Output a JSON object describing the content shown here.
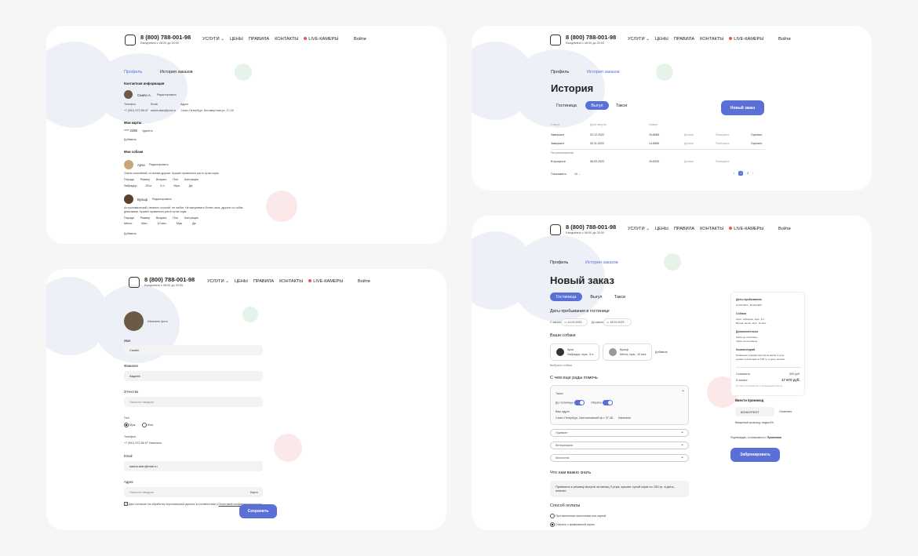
{
  "header": {
    "phone": "8 (800) 788-001-98",
    "hours": "Ежедневно с 08:00 до 20:00",
    "nav": [
      "УСЛУГИ ⌄",
      "ЦЕНЫ",
      "ПРАВИЛА",
      "КОНТАКТЫ",
      "LIVE-КАМЕРЫ"
    ],
    "login": "Войти"
  },
  "profile": {
    "tabs": [
      "Профиль",
      "История заказов"
    ],
    "contact_title": "Контактная информация",
    "name": "Семён А.",
    "edit": "Редактировать",
    "cols": [
      "Телефон",
      "Email",
      "Адрес"
    ],
    "vals": [
      "+7 (951) 572-86-97",
      "sasha.atan@post.ru",
      "Санкт-Петербург, Бессмертная ул. 17-18"
    ],
    "cards_title": "Мои карты",
    "card": "**** 2465",
    "card_del": "Удалить",
    "add": "Добавить",
    "dogs_title": "Мои собаки",
    "dog1": {
      "name": "Арчи",
      "edit": "Редактировать",
      "desc": "Очень спокойный, со всеми дружит. Кушает правильно раз в сутки корм.",
      "h": [
        "Порода",
        "Размер",
        "Возраст",
        "Пол",
        "Кастрация"
      ],
      "v": [
        "Лабрадор",
        "25 кг",
        "5 л.",
        "Муж.",
        "Да"
      ]
    },
    "dog2": {
      "name": "Вульф",
      "edit": "Редактировать",
      "desc": "Астрономический, немного строгий, не любит. Не выгуливать более часа, дружит со собак",
      "desc2": "девочками. Кушает правильно раз в сутки корм.",
      "h": [
        "Порода",
        "Размер",
        "Возраст",
        "Пол",
        "Кастрация"
      ],
      "v": [
        "Метис",
        "Мал.",
        "10 мес.",
        "Муж.",
        "Да"
      ]
    },
    "add2": "Добавить"
  },
  "history": {
    "tabs": [
      "Профиль",
      "История заказов"
    ],
    "title": "История",
    "types": [
      "Гостиница",
      "Выгул",
      "Такси"
    ],
    "new": "Новый заказ",
    "cols": [
      "Статус",
      "Дата выгула",
      "Номер"
    ],
    "rows": [
      [
        "Завершен",
        "22.12.2022",
        "19-8085",
        "Детали",
        "Повторить",
        "Оценить"
      ],
      [
        "Завершен",
        "03.11.2022",
        "14-8589",
        "Детали",
        "Повторить",
        "Оценить"
      ],
      [
        "В процессе",
        "06.03.2023",
        "19-8290",
        "Детали",
        "Повторить",
        ""
      ]
    ],
    "pending": "На рассмотрении",
    "show": "Показывать",
    "per": "10 ⌄",
    "pages": [
      "‹",
      "1",
      "2",
      "›"
    ]
  },
  "edit": {
    "photo": "Изменить фото",
    "name_l": "Имя",
    "name_v": "Семён",
    "surname_l": "Фамилия",
    "surname_v": "Авдеев",
    "patr_l": "Отчество",
    "patr_v": "Начните вводить",
    "sex_l": "Пол",
    "male": "Муж.",
    "female": "Жен.",
    "phone_l": "Телефон",
    "phone_v": "+7 (951) 572-86-97",
    "change": "Изменить",
    "email_l": "Email",
    "email_v": "sasha.atan@mail.ru",
    "addr_l": "Адрес",
    "addr_v": "Начните вводить",
    "map": "Карта",
    "consent": "Даю согласие на обработку персональных данных в соответствии с",
    "policy": "Политикой конфиденциальности",
    "save": "Сохранить"
  },
  "order": {
    "tabs": [
      "Профиль",
      "История заказов"
    ],
    "title": "Новый заказ",
    "types": [
      "Гостиница",
      "Выгул",
      "Такси"
    ],
    "dates_t": "Даты пребывания в гостинице",
    "from": "С какого",
    "from_v": "14.03.2023",
    "to": "До какого",
    "to_v": "18.03.2023",
    "dogs_t": "Ваши собаки",
    "dog1": "Арчи",
    "dog1d": "Лабрадор, муж., 5 л.",
    "dog2": "Вульф",
    "dog2d": "Метис, муж., 10 мес.",
    "add": "Добавить",
    "chosen": "Выбраны собаки",
    "help_t": "С чем еще рады помочь",
    "taxi": "Такси",
    "to_hotel": "До гостиницы",
    "back": "Обратно",
    "addr_t": "Ваш адрес",
    "addr": "Санкт-Петербург, Светлановский пр-т 37-38",
    "change": "Изменить",
    "opts": [
      "Грумминг",
      "Ветеринария",
      "Кинология"
    ],
    "know_t": "Что нам важно знать",
    "know": "Привыкли к режиму выгула за месяц 3 утра, кушает сухой корм по 150 гр. в день,",
    "know2": "молоко",
    "pay_t": "Способ оплаты",
    "pay1": "При заселении наличными или картой",
    "pay2": "Списать с привязанной карты",
    "side": {
      "dates_l": "Даты пребывания",
      "dates_v": "14.03.2023 - 18.03.2023",
      "dogs_l": "Собаки",
      "dogs_v": "Арчи, лабрадор, муж., 5 л.",
      "dogs_v2": "Вульф, метис, муж., 10 мес.",
      "extra_l": "Дополнительно",
      "extra_v": "Такси до гостиницы",
      "extra_v2": "Такси из гостиницы",
      "com_l": "Комментарий",
      "com_v": "Привыкли к режиму выгула за месяц 3 утра,",
      "com_v2": "кушает сухой корм по 150 гр. в день, молоко",
      "sum_l": "Стоимость",
      "sum_v": "500 руб.",
      "total_l": "К оплате",
      "total_v": "17 670 руб.",
      "note": "Оплата списывается с привязанной карты",
      "promo_t": "Ввести промокод",
      "promo": "КОНКУРЕНТ",
      "apply": "Отменить",
      "promo_note": "Введенный промокод: скидка 5%",
      "agree": "Подтверждая, я ознакомился с",
      "rules": "Правилами",
      "book": "Забронировать"
    }
  }
}
